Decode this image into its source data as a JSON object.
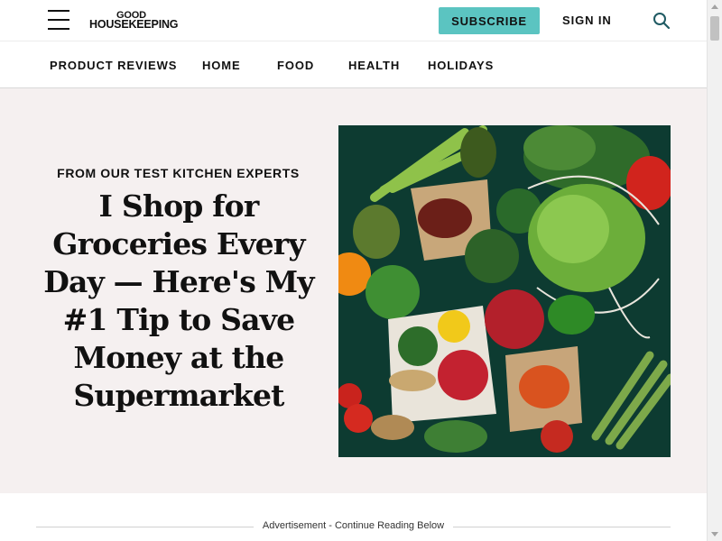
{
  "header": {
    "logo_line1": "GOOD",
    "logo_line2": "HOUSEKEEPING",
    "subscribe_label": "SUBSCRIBE",
    "signin_label": "SIGN IN",
    "icons": {
      "menu": "hamburger-menu-icon",
      "search": "search-icon"
    },
    "accent_color": "#5bc4c1"
  },
  "nav": {
    "items": [
      {
        "label": "PRODUCT REVIEWS"
      },
      {
        "label": "HOME"
      },
      {
        "label": "FOOD"
      },
      {
        "label": "HEALTH"
      },
      {
        "label": "HOLIDAYS"
      }
    ]
  },
  "hero": {
    "kicker": "FROM OUR TEST KITCHEN EXPERTS",
    "headline": "I Shop for Groceries Every Day — Here's My #1 Tip to Save Money at the Supermarket",
    "background_color": "#f5f0f0"
  },
  "ad": {
    "label": "Advertisement - Continue Reading Below"
  }
}
